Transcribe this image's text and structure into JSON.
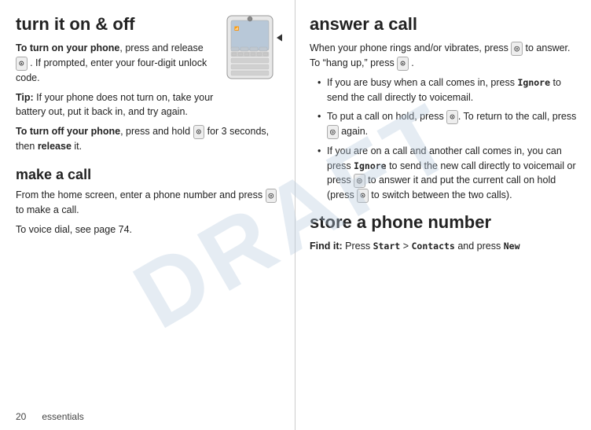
{
  "left": {
    "section1_title": "turn it on & off",
    "turn_on_label": "To turn on your phone",
    "turn_on_text1": ", press and release",
    "turn_on_key1": "⊙",
    "turn_on_text2": ". If prompted, enter your four-digit unlock code.",
    "tip_label": "Tip:",
    "tip_text": " If your phone does not turn on, take your battery out, put it back in, and try again.",
    "turn_off_label": "To turn off your phone",
    "turn_off_text": ", press and hold",
    "turn_off_key": "⊙",
    "turn_off_text2": " for 3 seconds, then ",
    "release_label": "release",
    "turn_off_text3": " it.",
    "section2_title": "make a call",
    "make_call_text": "From the home screen, enter a phone number and press",
    "make_call_key": "◎",
    "make_call_text2": " to make a call.",
    "voice_dial_text": "To voice dial, see page 74.",
    "page_number": "20",
    "page_label": "essentials"
  },
  "right": {
    "section1_title": "answer a call",
    "answer_intro": "When your phone rings and/or vibrates, press",
    "answer_key1": "◎",
    "answer_text1": " to answer. To “hang up,” press",
    "answer_key2": "⊙",
    "answer_text2": ".",
    "bullets": [
      {
        "text_before": "If you are busy when a call comes in, press ",
        "code": "Ignore",
        "text_after": " to send the call directly to voicemail."
      },
      {
        "text_before": "To put a call on hold, press ",
        "key": "⊙",
        "text_after": ". To return to the call, press ",
        "key2": "◎",
        "text_after2": " again."
      },
      {
        "text_before": "If you are on a call and another call comes in, you can press ",
        "code": "Ignore",
        "text_mid": " to send the new call directly to voicemail or press ",
        "key": "◎",
        "text_mid2": " to answer it and put the current call on hold (press ",
        "key2": "⊙",
        "text_after": " to switch between the two calls)."
      }
    ],
    "section2_title": "store a phone number",
    "find_it_label": "Find it:",
    "find_it_text": " Press ",
    "find_it_code1": "Start",
    "find_it_sep": " > ",
    "find_it_code2": "Contacts",
    "find_it_text2": " and press ",
    "find_it_code3": "New"
  }
}
